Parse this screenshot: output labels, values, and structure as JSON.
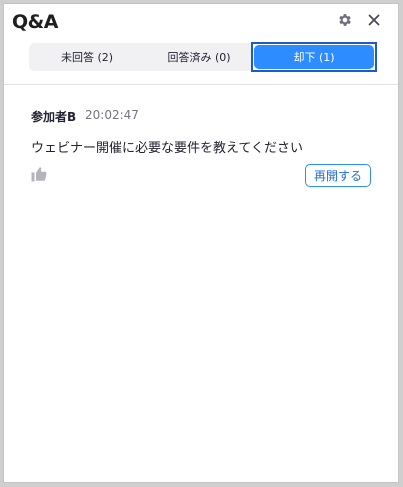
{
  "window": {
    "title": "Q&A"
  },
  "header": {
    "settings_icon": "gear-icon",
    "close_icon": "close-icon"
  },
  "tabs": [
    {
      "label": "未回答 (2)",
      "selected": false
    },
    {
      "label": "回答済み (0)",
      "selected": false
    },
    {
      "label": "却下 (1)",
      "selected": true
    }
  ],
  "question": {
    "author": "参加者B",
    "time": "20:02:47",
    "text": "ウェビナー開催に必要な要件を教えてください",
    "like_icon": "thumbs-up-icon",
    "reopen_label": "再開する"
  },
  "colors": {
    "accent": "#2d8cff",
    "selected_border": "#1c5cc4",
    "text": "#232333",
    "muted_text": "#747487"
  }
}
